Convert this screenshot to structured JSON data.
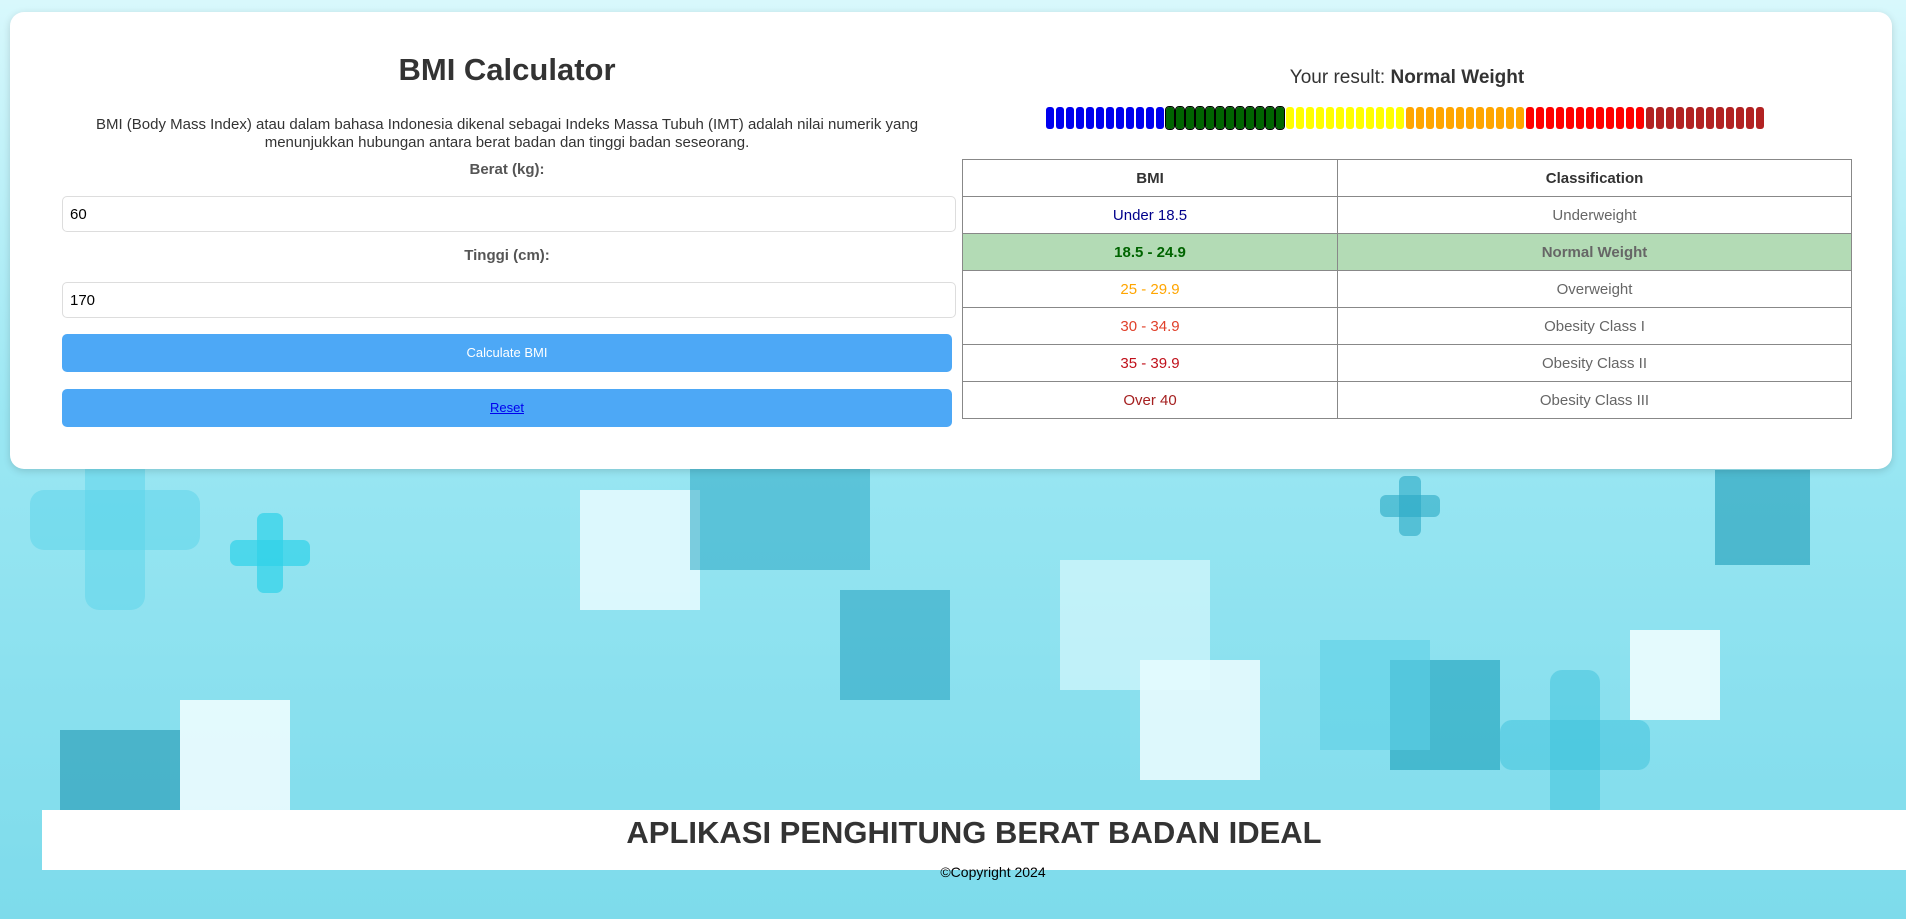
{
  "calculator": {
    "title": "BMI Calculator",
    "description": "BMI (Body Mass Index) atau dalam bahasa Indonesia dikenal sebagai Indeks Massa Tubuh (IMT) adalah nilai numerik yang menunjukkan hubungan antara berat badan dan tinggi badan seseorang.",
    "weight_label": "Berat (kg):",
    "weight_value": "60",
    "height_label": "Tinggi (cm):",
    "height_value": "170",
    "calculate_label": "Calculate BMI",
    "reset_label": "Reset"
  },
  "result": {
    "prefix": "Your result:",
    "value": "Normal Weight"
  },
  "scale": {
    "colors": [
      "#0000ee",
      "#006400",
      "#ffff00",
      "#ffa500",
      "#ff0000",
      "#b22222"
    ],
    "segments_per_color": 12
  },
  "table": {
    "headers": [
      "BMI",
      "Classification"
    ],
    "rows": [
      {
        "bmi": "Under 18.5",
        "classification": "Underweight",
        "color": "#00008b"
      },
      {
        "bmi": "18.5 - 24.9",
        "classification": "Normal Weight",
        "color": "#006400",
        "highlight": true
      },
      {
        "bmi": "25 - 29.9",
        "classification": "Overweight",
        "color": "#ffa500"
      },
      {
        "bmi": "30 - 34.9",
        "classification": "Obesity Class I",
        "color": "#e0402a"
      },
      {
        "bmi": "35 - 39.9",
        "classification": "Obesity Class II",
        "color": "#c0101a"
      },
      {
        "bmi": "Over 40",
        "classification": "Obesity Class III",
        "color": "#a52020"
      }
    ]
  },
  "footer": {
    "title": "APLIKASI PENGHITUNG BERAT BADAN IDEAL",
    "copyright": "©Copyright 2024"
  }
}
